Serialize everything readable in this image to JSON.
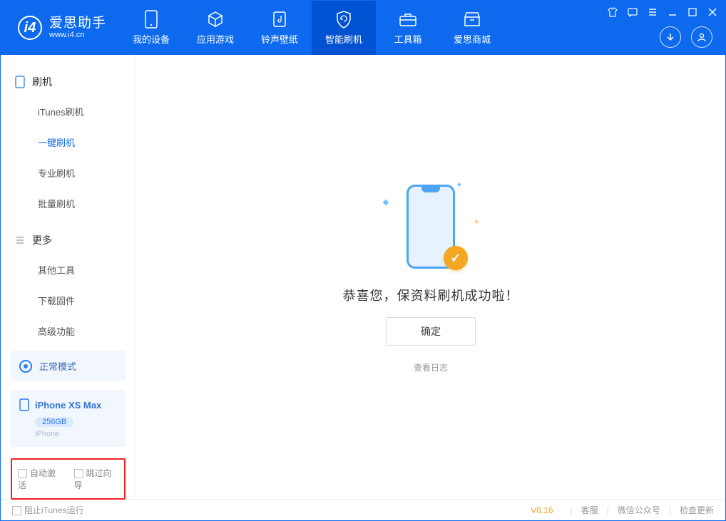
{
  "brand": {
    "name": "爱思助手",
    "url": "www.i4.cn"
  },
  "nav": {
    "my_device": "我的设备",
    "apps_games": "应用游戏",
    "ring_wallpaper": "铃声壁纸",
    "smart_flash": "智能刷机",
    "toolbox": "工具箱",
    "i4_mall": "爱思商城"
  },
  "sidebar": {
    "section_flash": "刷机",
    "itunes_flash": "iTunes刷机",
    "one_click_flash": "一键刷机",
    "pro_flash": "专业刷机",
    "batch_flash": "批量刷机",
    "section_more": "更多",
    "other_tools": "其他工具",
    "download_firmware": "下载固件",
    "advanced": "高级功能"
  },
  "mode": {
    "label": "正常模式"
  },
  "device": {
    "name": "iPhone XS Max",
    "storage": "256GB",
    "type": "iPhone"
  },
  "checks": {
    "auto_activate": "自动激活",
    "skip_guide": "跳过向导"
  },
  "main": {
    "success_msg": "恭喜您，保资料刷机成功啦！",
    "confirm": "确定",
    "view_log": "查看日志"
  },
  "footer": {
    "block_itunes": "阻止iTunes运行",
    "version": "V8.16",
    "support": "客服",
    "wechat": "微信公众号",
    "check_update": "检查更新"
  }
}
